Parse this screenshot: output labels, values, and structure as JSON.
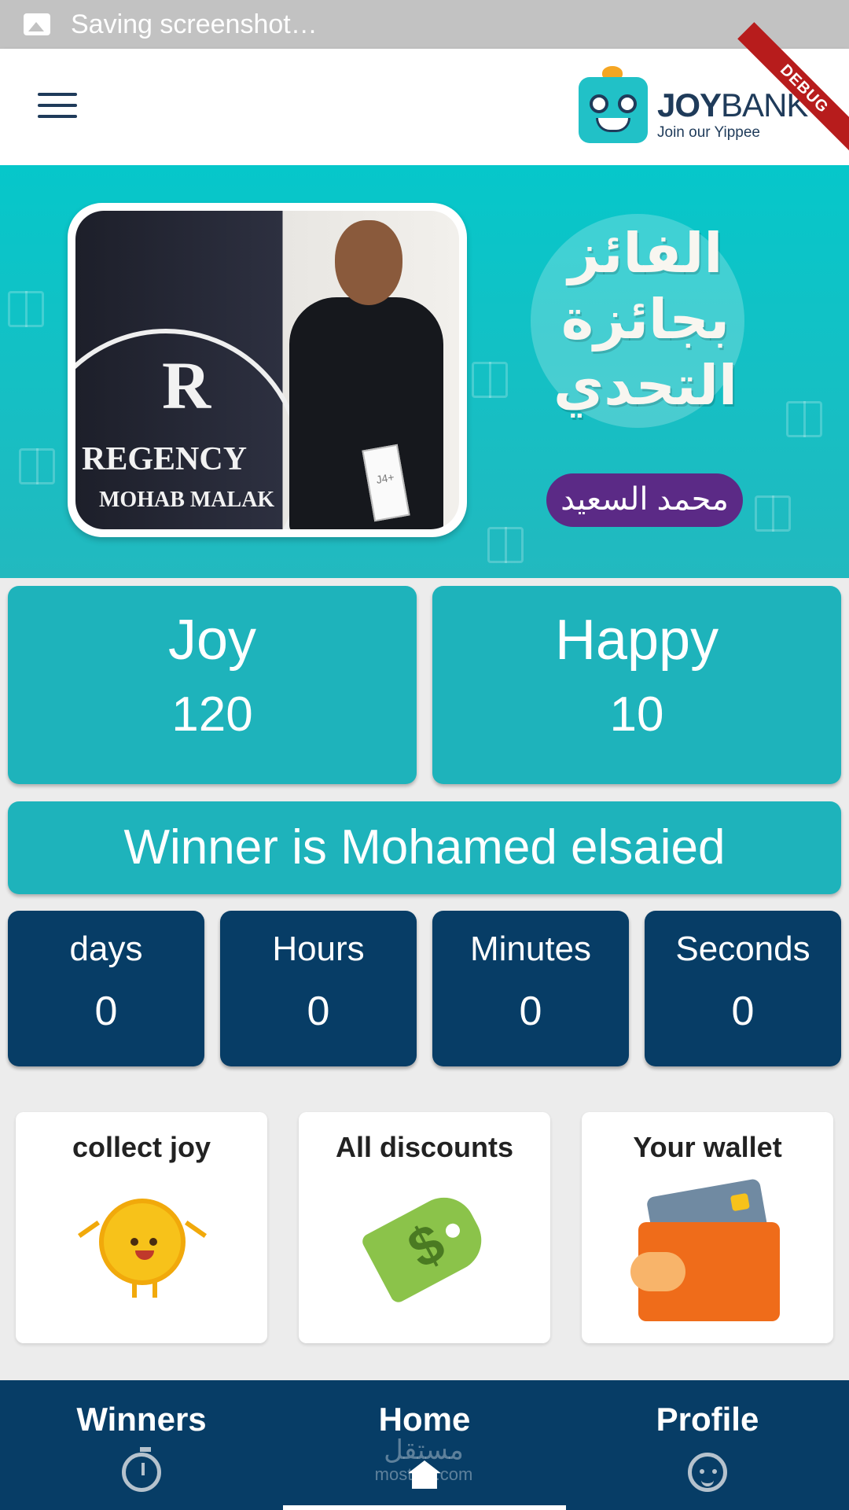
{
  "status_bar": {
    "text": "Saving screenshot…"
  },
  "app_bar": {
    "menu_icon": "hamburger-menu-icon",
    "logo": {
      "brand_bold": "JOY",
      "brand_light": "BANK",
      "tagline": "Join our Yippee"
    },
    "debug_ribbon": "DEBUG"
  },
  "banner": {
    "title_ar": "الفائز بجائزة التحدي",
    "name_ar": "محمد السعيد",
    "photo_sign": {
      "letter": "R",
      "line1": "REGENCY",
      "line2": "MOHAB MALAK"
    },
    "box_label": "J4+"
  },
  "stats": [
    {
      "label": "Joy",
      "value": "120"
    },
    {
      "label": "Happy",
      "value": "10"
    }
  ],
  "winner_text": "Winner is Mohamed elsaied",
  "countdown": [
    {
      "label": "days",
      "value": "0"
    },
    {
      "label": "Hours",
      "value": "0"
    },
    {
      "label": "Minutes",
      "value": "0"
    },
    {
      "label": "Seconds",
      "value": "0"
    }
  ],
  "actions": [
    {
      "label": "collect joy",
      "icon": "smiling-coin-icon"
    },
    {
      "label": "All discounts",
      "icon": "price-tag-icon"
    },
    {
      "label": "Your wallet",
      "icon": "wallet-icon"
    }
  ],
  "bottom_nav": [
    {
      "label": "Winners",
      "icon": "stopwatch-icon"
    },
    {
      "label": "Home",
      "icon": "home-icon",
      "active": true
    },
    {
      "label": "Profile",
      "icon": "face-icon"
    }
  ],
  "watermark": {
    "line1": "مستقل",
    "line2": "mostaql.com"
  },
  "colors": {
    "teal": "#1eb3bb",
    "navy": "#073d66",
    "purple": "#5b2a86"
  }
}
